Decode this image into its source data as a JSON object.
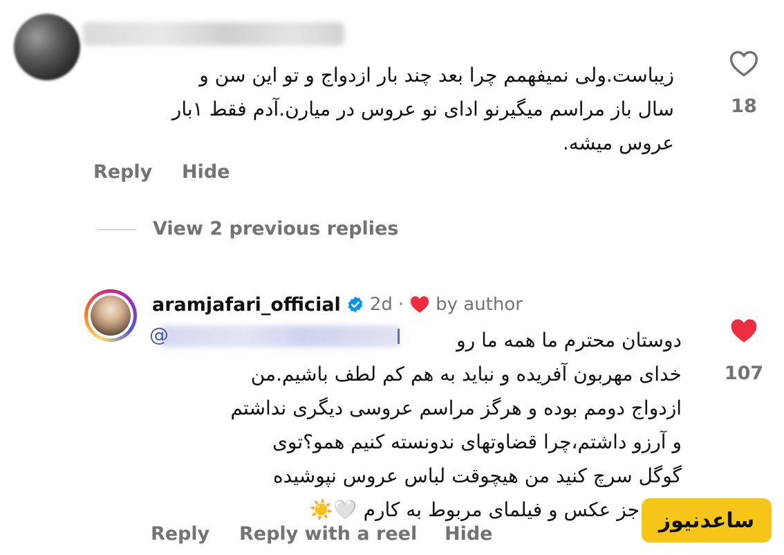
{
  "comment1": {
    "lines": [
      "زیباست.ولی نمیفهمم چرا بعد چند بار ازدواج و تو این سن و",
      "سال باز مراسم میگیرنو ادای نو عروس در میارن.آدم فقط ۱بار",
      "عروس میشه."
    ],
    "like_count": "18",
    "actions": {
      "reply": "Reply",
      "hide": "Hide"
    }
  },
  "view_replies": "View 2 previous replies",
  "comment2": {
    "username": "aramjafari_official",
    "time": "2d",
    "separator": "·",
    "by_author": "by author",
    "mention_at": "@",
    "lines": [
      "دوستان محترم ما همه ما رو",
      "خدای مهربون آفریده و نباید به هم کم لطف باشیم.من",
      "ازدواج دومم بوده و هرگز مراسم عروسی دیگری نداشتم",
      "و آرزو داشتم،چرا قضاوتهای ندونسته کنیم همو؟توی",
      "گوگل سرچ کنید من هیچوقت لباس عروس نپوشیده",
      "بودم جز عکس و فیلمای مربوط به کارم"
    ],
    "emoji_suffix": "🤍☀️",
    "like_count": "107",
    "actions": {
      "reply": "Reply",
      "reply_reel": "Reply with a reel",
      "hide": "Hide"
    }
  },
  "watermark": "ساعدنیوز",
  "colors": {
    "secondary_text": "#737373",
    "like_red": "#ed2e40",
    "verified_blue": "#0095f6",
    "watermark_bg": "#f5c518"
  },
  "icons": {
    "comment1_like": "heart-outline-icon",
    "comment2_like": "heart-filled-icon",
    "verified": "verified-badge-icon",
    "author_heart": "heart-filled-icon"
  }
}
